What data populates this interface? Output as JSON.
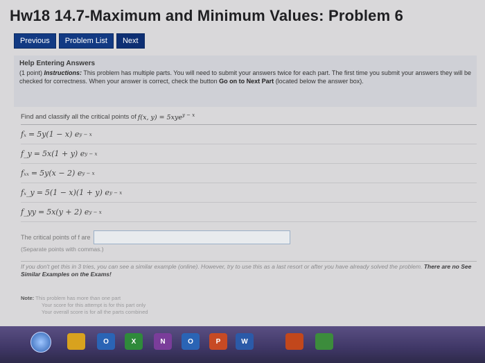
{
  "page": {
    "title": "Hw18 14.7-Maximum and Minimum Values: Problem 6"
  },
  "nav": {
    "previous": "Previous",
    "problem_list": "Problem List",
    "next": "Next"
  },
  "help": {
    "title": "Help Entering Answers",
    "points": "(1 point)",
    "instructions_label": "Instructions:",
    "text_before": "This problem has multiple parts. You will need to submit your answers twice for each part. The first time you submit your answers they will be checked for correctness. When your answer is correct, check the button",
    "bold_goto": "Go on to Next Part",
    "text_after": "(located below the answer box)."
  },
  "problem": {
    "prompt": "Find and classify all the critical points of",
    "function": "f(x, y) = 5xye",
    "function_exp": "y − x",
    "derivatives": [
      {
        "lhs": "fₓ",
        "rhs": "5y(1 − x) e",
        "exp": "y − x"
      },
      {
        "lhs": "f_y",
        "rhs": "5x(1 + y) e",
        "exp": "y − x"
      },
      {
        "lhs": "fₓₓ",
        "rhs": "5y(x − 2) e",
        "exp": "y − x"
      },
      {
        "lhs": "fₓ_y",
        "rhs": "5(1 − x)(1 + y) e",
        "exp": "y − x"
      },
      {
        "lhs": "f_yy",
        "rhs": "5x(y + 2) e",
        "exp": "y − x"
      }
    ],
    "critical_label": "The critical points of f are",
    "separate_note": "(Separate points with commas.)",
    "hint_text": "If you don't get this in 3 tries, you can see a similar example (online). However, try to use this as a last resort or after you have already solved the problem.",
    "hint_bold": "There are no See Similar Examples on the Exams!"
  },
  "note": {
    "label": "Note:",
    "line1": "This problem has more than one part",
    "line2": "Your score for this attempt is for this part only",
    "line3": "Your overall score is for all the parts combined"
  },
  "taskbar": {
    "icons": [
      {
        "name": "chrome-icon",
        "color": "#d8a21e"
      },
      {
        "name": "outlook-icon",
        "color": "#2a64b5",
        "label": "O"
      },
      {
        "name": "excel-icon",
        "color": "#2f8a3b",
        "label": "X"
      },
      {
        "name": "onenote-icon",
        "color": "#7a3d9a",
        "label": "N"
      },
      {
        "name": "outlook-blue-icon",
        "color": "#2a64b5",
        "label": "O"
      },
      {
        "name": "powerpoint-icon",
        "color": "#c74a24",
        "label": "P"
      },
      {
        "name": "word-icon",
        "color": "#2b5aa8",
        "label": "W"
      },
      {
        "name": "app-icon-orange",
        "color": "#c2471c"
      },
      {
        "name": "app-icon-green",
        "color": "#3c8c3c"
      }
    ]
  }
}
